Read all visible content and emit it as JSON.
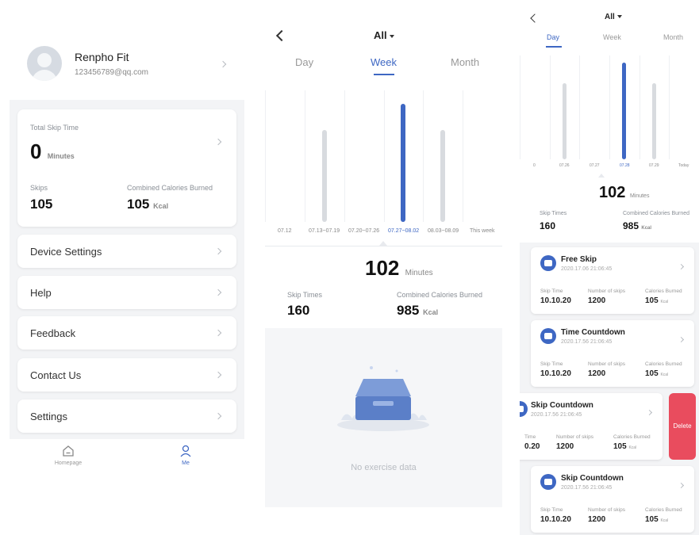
{
  "panel1": {
    "profile": {
      "name": "Renpho Fit",
      "email": "123456789@qq.com"
    },
    "stats": {
      "total_label": "Total Skip Time",
      "total_value": "0",
      "total_unit": "Minutes",
      "skips_label": "Skips",
      "skips_value": "105",
      "cal_label": "Combined Calories Burned",
      "cal_value": "105",
      "cal_unit": "Kcal"
    },
    "menu": [
      {
        "label": "Device Settings"
      },
      {
        "label": "Help"
      },
      {
        "label": "Feedback"
      },
      {
        "label": "Contact Us"
      },
      {
        "label": "Settings"
      }
    ],
    "tabbar": {
      "home": "Homepage",
      "me": "Me"
    },
    "accent": "#3e67c3"
  },
  "panel2": {
    "filter": "All",
    "tabs": [
      "Day",
      "Week",
      "Month"
    ],
    "active_tab": "Week",
    "summary": {
      "value": "102",
      "unit": "Minutes",
      "skip_label": "Skip Times",
      "skip_value": "160",
      "cal_label": "Combined Calories Burned",
      "cal_value": "985",
      "cal_unit": "Kcal"
    },
    "empty_text": "No exercise data"
  },
  "panel3": {
    "filter": "All",
    "tabs": [
      "Day",
      "Week",
      "Month"
    ],
    "active_tab": "Day",
    "summary": {
      "value": "102",
      "unit": "Minutes",
      "skip_label": "Skip Times",
      "skip_value": "160",
      "cal_label": "Combined Calories Burned",
      "cal_value": "985",
      "cal_unit": "Kcal"
    },
    "records": [
      {
        "title": "Free Skip",
        "date": "2020.17.06 21:06:45",
        "time_label": "Skip Time",
        "time": "10.10.20",
        "skips_label": "Number of skips",
        "skips": "1200",
        "cal_label": "Calories Burned",
        "cal": "105",
        "cal_unit": "Kcal"
      },
      {
        "title": "Time Countdown",
        "date": "2020.17.56 21:06:45",
        "time_label": "Skip Time",
        "time": "10.10.20",
        "skips_label": "Number of skips",
        "skips": "1200",
        "cal_label": "Calories Burned",
        "cal": "105",
        "cal_unit": "Kcal"
      },
      {
        "title": "Skip Countdown",
        "date": "2020.17.56 21:06:45",
        "time_label": "Time",
        "time": "0.20",
        "skips_label": "Number of skips",
        "skips": "1200",
        "cal_label": "Calories Burned",
        "cal": "105",
        "cal_unit": "Kcal"
      },
      {
        "title": "Skip Countdown",
        "date": "2020.17.56 21:06:45",
        "time_label": "Skip Time",
        "time": "10.10.20",
        "skips_label": "Number of skips",
        "skips": "1200",
        "cal_label": "Calories Burned",
        "cal": "105",
        "cal_unit": "Kcal"
      }
    ],
    "delete_label": "Delete",
    "delete_color": "#e94c5e"
  },
  "chart_data": [
    {
      "type": "bar",
      "categories": [
        "07.12",
        "07.13~07.19",
        "07.20~07.26",
        "07.27~08.02",
        "08.03~08.09",
        "This week"
      ],
      "values": [
        0,
        70,
        0,
        90,
        70,
        0
      ],
      "highlight": "07.27~08.02",
      "ylim": [
        0,
        100
      ]
    },
    {
      "type": "bar",
      "categories": [
        "0",
        "07.26",
        "07.27",
        "07.28",
        "07.29",
        "Today"
      ],
      "values": [
        0,
        73,
        0,
        93,
        73,
        0
      ],
      "highlight": "07.28",
      "ylim": [
        0,
        100
      ]
    }
  ]
}
